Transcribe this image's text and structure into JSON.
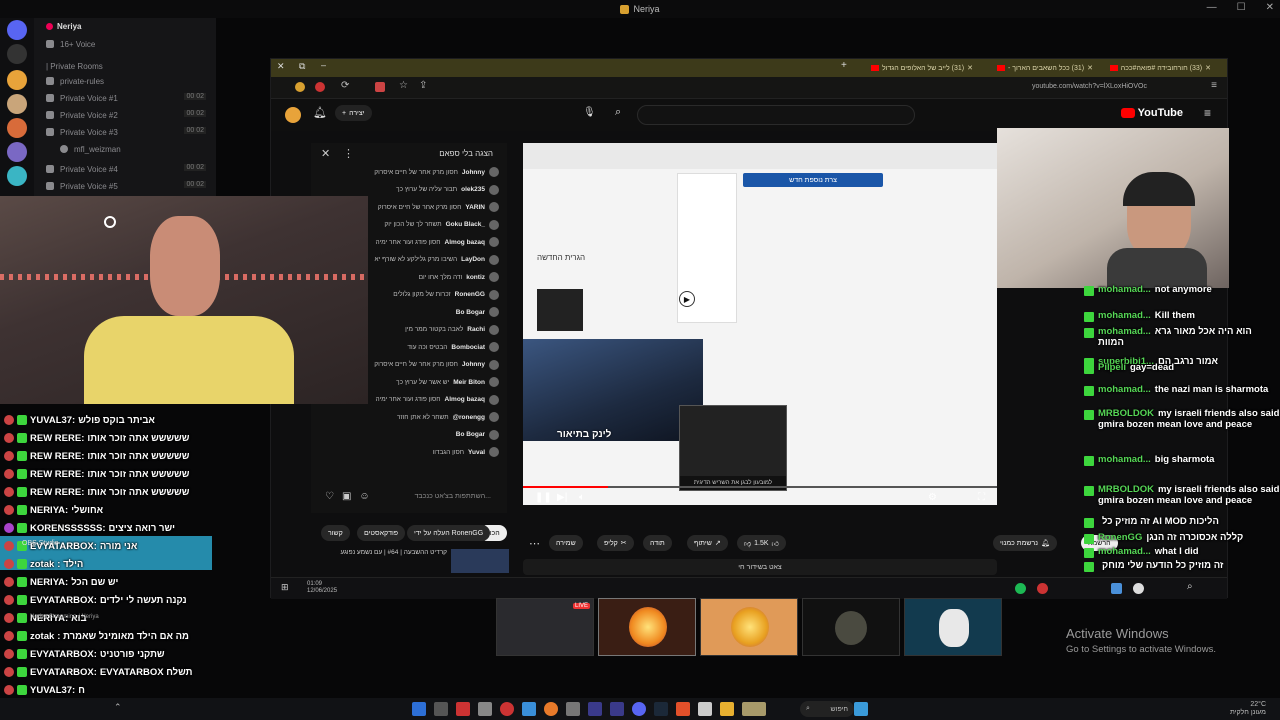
{
  "outer_window": {
    "title": "Neriya"
  },
  "discord": {
    "server_name": "Neriya",
    "channels": [
      {
        "label": "16+ Voice",
        "count": ""
      },
      {
        "label": "| Private Rooms",
        "count": ""
      },
      {
        "label": "private-rules",
        "count": ""
      },
      {
        "label": "Private Voice #1",
        "count": "00 02"
      },
      {
        "label": "Private Voice #2",
        "count": "00 02"
      },
      {
        "label": "Private Voice #3",
        "count": "00 02"
      },
      {
        "label": "mfl_weizman",
        "count": ""
      },
      {
        "label": "Private Voice #4",
        "count": "00 02"
      },
      {
        "label": "Private Voice #5",
        "count": "00 02"
      }
    ]
  },
  "overlay_chat": [
    {
      "name": "YUVAL37:",
      "msg": "אביתר בוקס פולש",
      "badge": "#c44"
    },
    {
      "name": "REW RERE:",
      "msg": "ששששש אתה זוכר אותו",
      "badge": "#c44"
    },
    {
      "name": "REW RERE:",
      "msg": "ששששש אתה זוכר אותו",
      "badge": "#c44"
    },
    {
      "name": "REW RERE:",
      "msg": "ששששש אתה זוכר אותו",
      "badge": "#c44"
    },
    {
      "name": "REW RERE:",
      "msg": "ששששש אתה זוכר אותו",
      "badge": "#c44"
    },
    {
      "name": "NERIYA:",
      "msg": "אחושלי",
      "badge": "#c44"
    },
    {
      "name": "KORENSSSSSS:",
      "msg": "ישר רואה ציצים",
      "badge": "#a4c"
    },
    {
      "name": "EVYATARBOX:",
      "msg": "אני מורה",
      "badge": "#c44"
    },
    {
      "name": "zotak",
      "msg": ": הילד",
      "badge": "#c44"
    },
    {
      "name": "NERIYA:",
      "msg": "יש שם הכל",
      "badge": "#c44"
    },
    {
      "name": "EVYATARBOX:",
      "msg": "נקנה תעשה לי ילדים",
      "badge": "#c44"
    },
    {
      "name": "NERIYA:",
      "msg": "בוא",
      "badge": "#c44"
    },
    {
      "name": "zotak",
      "msg": ": מה אם הילד מאומינל שאמרת",
      "badge": "#c44"
    },
    {
      "name": "EVYATARBOX:",
      "msg": "שתקני פורטניט",
      "badge": "#c44"
    },
    {
      "name": "EVYATARBOX:",
      "msg": "EVYATARBOX תשלח",
      "badge": "#c44"
    },
    {
      "name": "YUVAL37:",
      "msg": "ח",
      "badge": "#c44"
    }
  ],
  "overlay_misc": {
    "obs": "OBS Studio",
    "streaming": "Neriya Streaming / Neriya"
  },
  "browser": {
    "tabs": [
      {
        "label": "(31) לייב של האלופים הגדול"
      },
      {
        "label": "(31) ככל השאבים הארוך -"
      },
      {
        "label": "(33) חורחובידה #פואה#ככה"
      }
    ],
    "url": "youtube.com/watch?v=lXLoxHiOVOc"
  },
  "youtube": {
    "logo": "YouTube",
    "create": "יצירה",
    "chat_header": "הצגה בלי ספאם",
    "chat": [
      {
        "name": "Johnny",
        "msg": "חסון מרק אחר של חיים איסרוק"
      },
      {
        "name": "olek235",
        "msg": "תבור עליה של ערוץ כך"
      },
      {
        "name": "YARIN",
        "msg": "חסון מרק אחר של חיים איסרוק"
      },
      {
        "name": "Goku Black_",
        "msg": "תשחר לך של הכון יוק"
      },
      {
        "name": "Almog bazaq",
        "msg": "חסון פודג ועור אחר ימיה"
      },
      {
        "name": "LayDon",
        "msg": "השיבו מרק גלילקע לא שורף יא"
      },
      {
        "name": "kontiz",
        "msg": "ודה מלך אחו יום"
      },
      {
        "name": "RonenGG",
        "msg": "זכרות של מקון גלולים"
      },
      {
        "name": "Bo Bogar",
        "msg": ""
      },
      {
        "name": "Rachi",
        "msg": "לאבה בקטור ממר מין"
      },
      {
        "name": "Bombociat",
        "msg": "הבטיס וכה עוד"
      },
      {
        "name": "Johnny",
        "msg": "חסון מרק אחר של חיים איסרוק"
      },
      {
        "name": "Meir Biton",
        "msg": "יש אשר של ערוץ כך"
      },
      {
        "name": "Almog bazaq",
        "msg": "חסון פודג ועור אחר ימיה"
      },
      {
        "name": "@ronengg",
        "msg": "תשחר לא אתן חוזר"
      },
      {
        "name": "Bo Bogar",
        "msg": ""
      },
      {
        "name": "Yuval",
        "msg": "חסון הגבדוו"
      }
    ],
    "chat_input_placeholder": "השתתפות בצ'אט כנכבד...",
    "video_caption": "לינק בתיאור",
    "pip_caption": "למובעון לבגן את השריש הדיגית",
    "sheet_title": "הגרית החדשה",
    "sheet_button": "צרת נוספת חדש",
    "under_video": {
      "likes": "1.5K",
      "share": "שיתוף",
      "clip": "קליפ",
      "save": "שמירה",
      "thanks": "תודה",
      "subscribe": "הרשמה",
      "channel": "RonenGG",
      "joined": "נרשמת כמנוי"
    },
    "description": "צאט בשידור חי",
    "related_tabs": [
      "הכול",
      "העלה על ידי RonenGG",
      "פודקאסטים",
      "קשור"
    ],
    "related_title": "קרדיט ההשבעה | #64 | עם נשמע נפוגע"
  },
  "kick_chat": [
    {
      "name": "mohamad...",
      "msg": "not anymore"
    },
    {
      "name": "mohamad...",
      "msg": "Kill them"
    },
    {
      "name": "mohamad...",
      "msg": "הוא היה אכל מאור גרא המוות"
    },
    {
      "name": "superbibi1...",
      "msg": "אמור נרגב הם"
    },
    {
      "name": "Pilpeli",
      "msg": "gay=dead"
    },
    {
      "name": "mohamad...",
      "msg": "the nazi man is sharmota"
    },
    {
      "name": "MRBOLDOK",
      "msg": "my israeli friends also said gmira bozen mean love and peace"
    },
    {
      "name": "mohamad...",
      "msg": "big sharmota"
    },
    {
      "name": "MRBOLDOK",
      "msg": "my israeli friends also said gmira bozen mean love and peace"
    },
    {
      "name": "",
      "msg": "זה מוזיק כל AI MOD הליכות"
    },
    {
      "name": "RonenGG",
      "msg": "קללה אכסוכרה זה הנגן"
    },
    {
      "name": "mohamad...",
      "msg": "what I did"
    },
    {
      "name": "",
      "msg": "זה מוזיק כל הודעה שלי מוחק"
    }
  ],
  "activate_windows": {
    "line1": "Activate Windows",
    "line2": "Go to Settings to activate Windows."
  },
  "stream_tiles": {
    "live": "LIVE"
  },
  "inner_taskbar": {
    "time": "01:09",
    "date": "12/06/2025"
  },
  "taskbar": {
    "search": "חיפוש",
    "temp": "22°C",
    "weather": "מעונן חלקית"
  }
}
